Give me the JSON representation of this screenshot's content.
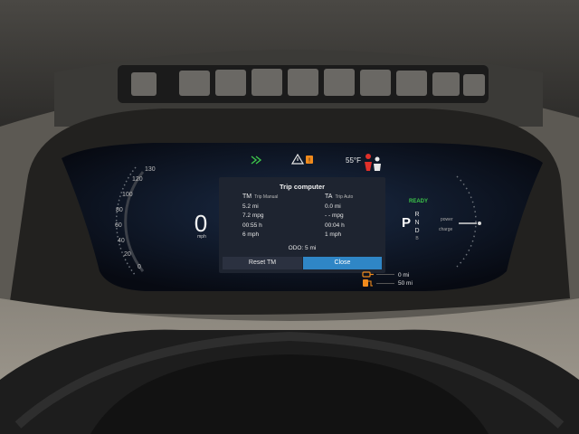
{
  "speedometer": {
    "speed": "0",
    "unit": "mph",
    "ticks": [
      "130",
      "120",
      "100",
      "80",
      "60",
      "40",
      "20",
      "0"
    ]
  },
  "status_bar": {
    "outside_temp": "55°F",
    "icons": [
      "headlight-icon",
      "warning-triangle-icon",
      "service-icon",
      "seatbelt-icon"
    ]
  },
  "trip_computer": {
    "title": "Trip computer",
    "manual": {
      "abbr": "TM",
      "name": "Trip Manual",
      "distance": "5.2 mi",
      "economy": "7.2 mpg",
      "time": "00:55 h",
      "avg_speed": "6 mph"
    },
    "auto": {
      "abbr": "TA",
      "name": "Trip Auto",
      "distance": "0.0 mi",
      "economy": "- - mpg",
      "time": "00:04 h",
      "avg_speed": "1 mph"
    },
    "odometer": "ODO:  5 mi",
    "reset_label": "Reset TM",
    "close_label": "Close"
  },
  "drive_gauge": {
    "ready": "READY",
    "gear_selected": "P",
    "gears": [
      "R",
      "N",
      "D",
      "B"
    ],
    "power_label": "power",
    "charge_label": "charge"
  },
  "range": {
    "electric": "0 mi",
    "fuel": "50 mi"
  },
  "colors": {
    "accent_blue": "#2f86c6",
    "ready_green": "#3cc64a",
    "warning_orange": "#f08a1c",
    "warning_red": "#e0302a"
  }
}
